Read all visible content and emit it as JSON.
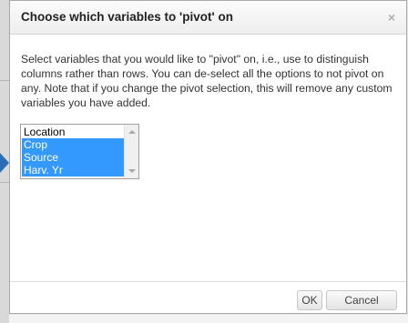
{
  "dialog": {
    "title": "Choose which variables to 'pivot' on",
    "close_label": "×",
    "description": "Select variables that you would like to \"pivot\" on, i.e., use to distinguish columns rather than rows. You can de-select all the options to not pivot on any. Note that if you change the pivot selection, this will remove any custom variables you have added.",
    "options": [
      {
        "label": "Location",
        "selected": false
      },
      {
        "label": "Crop",
        "selected": true
      },
      {
        "label": "Source",
        "selected": true
      },
      {
        "label": "Harv. Yr",
        "selected": true
      }
    ],
    "ok_label": "OK",
    "cancel_label": "Cancel"
  },
  "colors": {
    "selection": "#3399ff",
    "arrow": "#2a6fb5"
  }
}
